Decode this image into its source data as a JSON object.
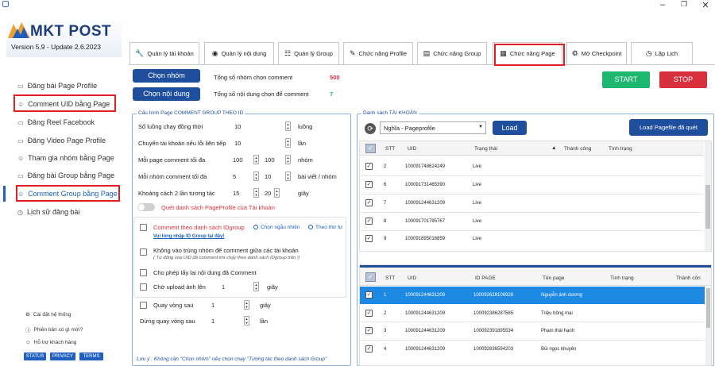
{
  "app": {
    "logo_text": "MKT POST",
    "version": "Version 5.9 - Update 2.6.2023"
  },
  "sidebar": {
    "items": [
      {
        "label": "Đăng bài Page Profile"
      },
      {
        "label": "Comment UID bằng Page"
      },
      {
        "label": "Đăng Reel Facebook"
      },
      {
        "label": "Đăng Video Page Profile"
      },
      {
        "label": "Tham gia nhóm bằng Page"
      },
      {
        "label": "Đăng bài Group bằng Page"
      },
      {
        "label": "Comment Group bằng Page"
      },
      {
        "label": "Lịch sử đăng bài"
      }
    ],
    "footer": [
      {
        "label": "Cài đặt hệ thống"
      },
      {
        "label": "Phiên bản có gì mới?"
      },
      {
        "label": "Hỗ trợ khách hàng"
      }
    ],
    "badges": [
      "STATUS",
      "PRIVACY",
      "TERMS"
    ]
  },
  "tabs": [
    {
      "label": "Quản lý tài khoản"
    },
    {
      "label": "Quản lý nội dung"
    },
    {
      "label": "Quản lý Group"
    },
    {
      "label": "Chức năng Profile"
    },
    {
      "label": "Chức năng Group"
    },
    {
      "label": "Chức năng Page"
    },
    {
      "label": "Mở Checkpoint"
    },
    {
      "label": "Lập Lịch"
    }
  ],
  "top": {
    "btn_group": "Chọn nhóm",
    "btn_content": "Chọn nội dung",
    "group_label": "Tổng số nhóm chọn comment",
    "group_count": "500",
    "content_label": "Tổng số nội dung chọn để comment",
    "content_count": "7",
    "start": "START",
    "stop": "STOP"
  },
  "config": {
    "legend": "Cấu hình Page COMMENT GROUP THEO ID",
    "rows": [
      {
        "label": "Số luồng chạy đồng thời",
        "v1": "10",
        "unit": "luồng"
      },
      {
        "label": "Chuyển tài khoản nếu lỗi liên tiếp",
        "v1": "10",
        "unit": "lần"
      },
      {
        "label": "Mỗi page comment tối đa",
        "v1": "100",
        "v2": "100",
        "unit": "nhóm"
      },
      {
        "label": "Mỗi nhóm comment tối đa",
        "v1": "5",
        "v2": "10",
        "unit": "bài viết / nhóm"
      },
      {
        "label": "Khoảng cách 2 lần tương tác",
        "v1": "15",
        "v2": "20",
        "unit": "giây"
      }
    ],
    "toggle_label": "Quét danh sách PageProfile của Tài khoản",
    "opt_comment_label": "Comment theo danh sách IDgroup",
    "opt_random": "Chọn ngẫu nhiên",
    "opt_order": "Theo thứ tự",
    "opt_link": "Vui lòng nhập ID Group tại đây!",
    "opt_no_dup": "Không vào trùng nhóm để comment giữa các tài khoản",
    "opt_no_dup_note": "( Tự động xóa UID đã comment khi chạy theo danh sách IDgroup trên !)",
    "opt_allow_dup": "Cho phép lấy lại nội dung đã Comment",
    "opt_wait_label": "Chờ upload ảnh lên",
    "opt_wait_val": "1",
    "opt_wait_unit": "giây",
    "loop_label": "Quay vòng sau",
    "loop_val": "1",
    "loop_unit": "giây",
    "stop_label": "Dừng quay vòng sau",
    "stop_val": "1",
    "stop_unit": "lần",
    "note": "Lưu ý : Không cần \"Chọn nhóm\" nếu chọn chạy \"Tương tác theo danh sách Group\""
  },
  "accounts": {
    "legend": "Danh sách TÀI KHOẢN",
    "select_value": "Nghĩa - Pageprofile",
    "load": "Load",
    "load_scan": "Load Pagefile đã quét",
    "columns": [
      "STT",
      "UID",
      "Trạng thái",
      "Thành công",
      "Tình trạng"
    ],
    "rows": [
      {
        "stt": "2",
        "uid": "100091748624249",
        "status": "Live"
      },
      {
        "stt": "6",
        "uid": "100091731465390",
        "status": "Live"
      },
      {
        "stt": "7",
        "uid": "100091244631209",
        "status": "Live"
      },
      {
        "stt": "8",
        "uid": "100091701795767",
        "status": "Live"
      },
      {
        "stt": "9",
        "uid": "100091895016859",
        "status": "Live"
      }
    ]
  },
  "pages": {
    "columns": [
      "STT",
      "UID",
      "ID PAGE",
      "Tên page",
      "Tình trạng",
      "Thành côn"
    ],
    "rows": [
      {
        "stt": "1",
        "uid": "100091244631209",
        "page_id": "100092628106928",
        "name": "Nguyễn ánh dương"
      },
      {
        "stt": "2",
        "uid": "100091244631209",
        "page_id": "100092386287585",
        "name": "Triệu hồng mai"
      },
      {
        "stt": "3",
        "uid": "100091244631209",
        "page_id": "100092391895534",
        "name": "Phạm thái hạnh"
      },
      {
        "stt": "4",
        "uid": "100091244631209",
        "page_id": "100092836594203",
        "name": "Bùi ngọc khuyên"
      }
    ]
  },
  "colors": {
    "accent": "#1f4f9c",
    "highlight": "#e02020",
    "start": "#1db76f",
    "stop": "#d9303e",
    "selected_row": "#1e88e5"
  }
}
